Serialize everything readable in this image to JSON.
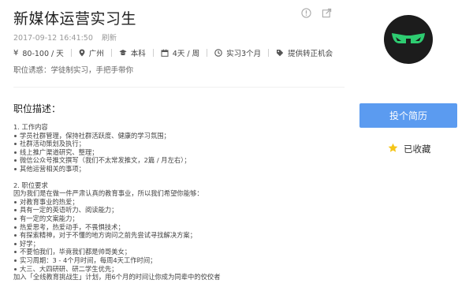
{
  "job": {
    "title": "新媒体运营实习生",
    "timestamp": "2017-09-12 16:41:50",
    "refresh_label": "刷新",
    "tags": {
      "salary": "80-100 / 天",
      "city": "广州",
      "education": "本科",
      "days": "4天 / 周",
      "duration": "实习3个月",
      "conversion": "提供转正机会"
    },
    "lure": "职位诱惑：学徒制实习，手把手带你"
  },
  "description": {
    "heading": "职位描述：",
    "section1_title": "1. 工作内容",
    "section1_items": [
      "学员社群管理，保持社群活跃度、健康的学习氛围；",
      "社群活动策划及执行；",
      "线上推广渠道研究、整理；",
      "微信公众号推文撰写（我们不太常发推文，2篇 / 月左右）；",
      "其他运营相关的事项；"
    ],
    "section2_title": "2. 职位要求",
    "section2_intro": "因为我们是在做一件严肃认真的教育事业，所以我们希望你能够：",
    "section2_items": [
      "对教育事业的热爱；",
      "具有一定的英语听力、阅读能力；",
      "有一定的文案能力；",
      "热爱思考，热爱动手，不畏惧技术；",
      "有探索精神，对于不懂的地方询问之前先尝试寻找解决方案；",
      "好学；",
      "不要怕我们，毕竟我们都是帅哥美女；",
      "实习周期：3 - 4个月时间，每周4天工作时间；",
      "大三、大四研研、研二学生优先；"
    ],
    "footer": "加入「全线教育挑战生」计划，用6个月的时间让你成为同辈中的佼佼者"
  },
  "actions": {
    "apply_label": "投个简历",
    "favorite_label": "已收藏"
  },
  "colors": {
    "accent": "#5b9bf0",
    "logo_bg": "#1c1c1c",
    "logo_green": "#2ecc71",
    "star": "#f5c518"
  }
}
